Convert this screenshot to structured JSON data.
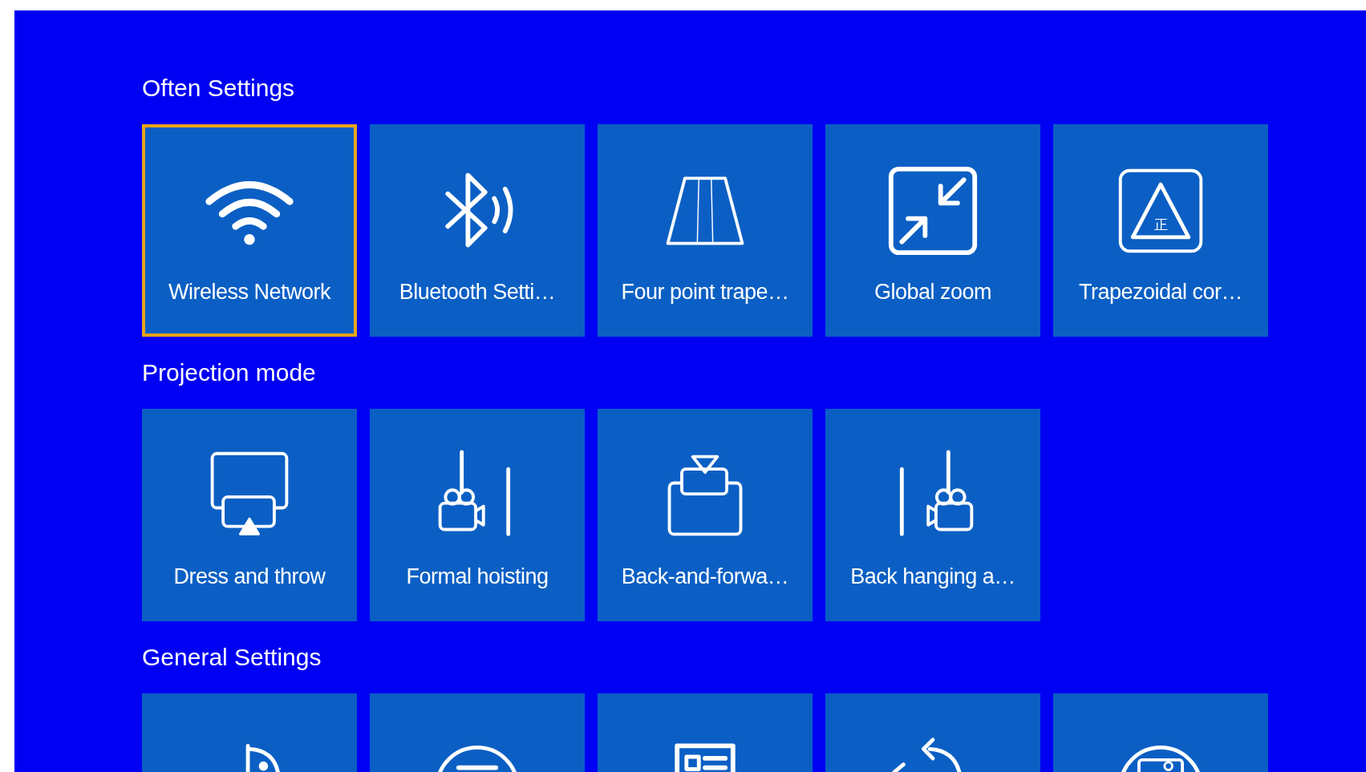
{
  "sections": [
    {
      "title": "Often Settings",
      "tiles": [
        {
          "kind": "wifi",
          "label": "Wireless Network",
          "selected": true
        },
        {
          "kind": "bluetooth",
          "label": "Bluetooth Setti…",
          "selected": false
        },
        {
          "kind": "trapezoid",
          "label": "Four point trape…",
          "selected": false
        },
        {
          "kind": "zoom",
          "label": "Global zoom",
          "selected": false
        },
        {
          "kind": "keystone",
          "label": "Trapezoidal cor…",
          "icon_mark": "正",
          "selected": false
        }
      ]
    },
    {
      "title": "Projection mode",
      "tiles": [
        {
          "kind": "front",
          "label": "Dress and throw",
          "selected": false
        },
        {
          "kind": "ceiling",
          "label": "Formal hoisting",
          "selected": false
        },
        {
          "kind": "rear",
          "label": "Back-and-forwa…",
          "selected": false
        },
        {
          "kind": "rear-ceiling",
          "label": "Back hanging a…",
          "selected": false
        }
      ]
    },
    {
      "title": "General Settings",
      "tiles": [
        {
          "kind": "clock",
          "selected": false
        },
        {
          "kind": "menu",
          "selected": false
        },
        {
          "kind": "card",
          "selected": false
        },
        {
          "kind": "rotate",
          "selected": false
        },
        {
          "kind": "picture",
          "selected": false
        }
      ]
    }
  ]
}
